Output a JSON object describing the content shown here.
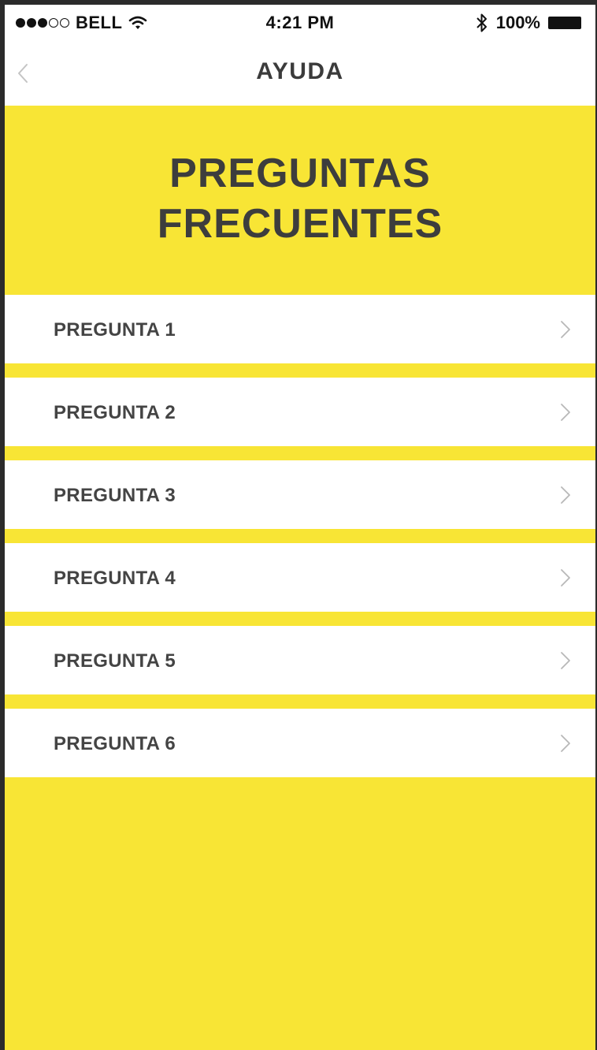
{
  "status_bar": {
    "carrier": "BELL",
    "time": "4:21 PM",
    "battery": "100%",
    "signal": {
      "filled": 3,
      "total": 5
    },
    "icons": [
      "wifi-icon",
      "bluetooth-icon",
      "battery-icon"
    ]
  },
  "nav": {
    "title": "AYUDA",
    "back_icon": "chevron-left-icon"
  },
  "hero": {
    "title_line1": "PREGUNTAS",
    "title_line2": "FRECUENTES"
  },
  "faq": {
    "items": [
      {
        "label": "PREGUNTA 1"
      },
      {
        "label": "PREGUNTA 2"
      },
      {
        "label": "PREGUNTA 3"
      },
      {
        "label": "PREGUNTA 4"
      },
      {
        "label": "PREGUNTA 5"
      },
      {
        "label": "PREGUNTA 6"
      }
    ],
    "item_icon": "chevron-right-icon"
  },
  "colors": {
    "accent": "#f8e535",
    "text": "#444444",
    "surface": "#ffffff",
    "chevron": "#b8b8b8"
  }
}
